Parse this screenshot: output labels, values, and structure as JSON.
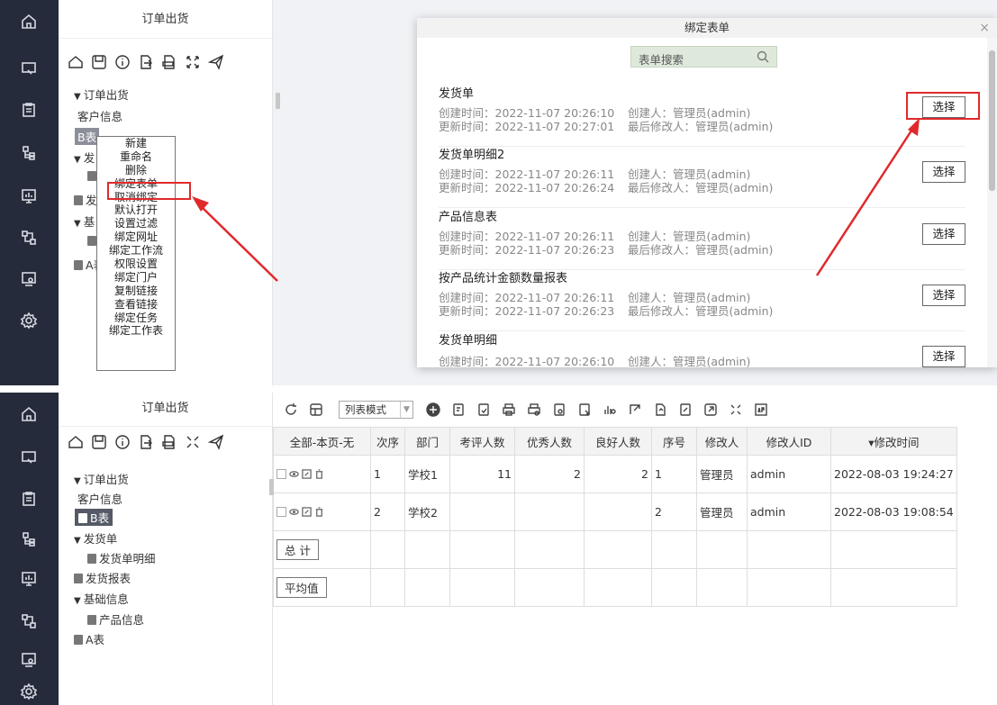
{
  "top": {
    "tree_title": "订单出货",
    "tree": [
      {
        "label": "订单出货",
        "caret": "▼"
      },
      {
        "label": "客户信息"
      },
      {
        "label": "B表"
      },
      {
        "label": "发"
      },
      {
        "label": "发"
      },
      {
        "label": "基"
      },
      {
        "label": "A表"
      }
    ],
    "context_menu": [
      "新建",
      "重命名",
      "删除",
      "绑定表单",
      "取消绑定",
      "默认打开",
      "设置过滤",
      "绑定网址",
      "绑定工作流",
      "权限设置",
      "绑定门户",
      "复制链接",
      "查看链接",
      "绑定任务",
      "绑定工作表"
    ],
    "dialog": {
      "title": "绑定表单",
      "close": "×",
      "search_placeholder": "表单搜索",
      "forms": [
        {
          "name": "发货单",
          "created": "创建时间：2022-11-07 20:26:10",
          "creator": "创建人：管理员(admin)",
          "updated": "更新时间：2022-11-07 20:27:01",
          "modifier": "最后修改人：管理员(admin)",
          "button": "选择"
        },
        {
          "name": "发货单明细2",
          "created": "创建时间：2022-11-07 20:26:11",
          "creator": "创建人：管理员(admin)",
          "updated": "更新时间：2022-11-07 20:26:24",
          "modifier": "最后修改人：管理员(admin)",
          "button": "选择"
        },
        {
          "name": "产品信息表",
          "created": "创建时间：2022-11-07 20:26:11",
          "creator": "创建人：管理员(admin)",
          "updated": "更新时间：2022-11-07 20:26:23",
          "modifier": "最后修改人：管理员(admin)",
          "button": "选择"
        },
        {
          "name": "按产品统计金额数量报表",
          "created": "创建时间：2022-11-07 20:26:11",
          "creator": "创建人：管理员(admin)",
          "updated": "更新时间：2022-11-07 20:26:23",
          "modifier": "最后修改人：管理员(admin)",
          "button": "选择"
        },
        {
          "name": "发货单明细",
          "created": "创建时间：2022-11-07 20:26:10",
          "creator": "创建人：管理员(admin)",
          "updated": "",
          "modifier": "",
          "button": "选择"
        }
      ]
    }
  },
  "bottom": {
    "tree_title": "订单出货",
    "tree": [
      {
        "label": "订单出货",
        "caret": "▼"
      },
      {
        "label": "客户信息"
      },
      {
        "label": "B表"
      },
      {
        "label": "发货单",
        "caret": "▼"
      },
      {
        "label": "发货单明细"
      },
      {
        "label": "发货报表"
      },
      {
        "label": "基础信息",
        "caret": "▼"
      },
      {
        "label": "产品信息"
      },
      {
        "label": "A表"
      }
    ],
    "view_mode": "列表模式",
    "columns": [
      "全部-本页-无",
      "次序",
      "部门",
      "考评人数",
      "优秀人数",
      "良好人数",
      "序号",
      "修改人",
      "修改人ID",
      "▾修改时间"
    ],
    "rows": [
      {
        "order": "1",
        "dept": "学校1",
        "eval": "11",
        "excellent": "2",
        "good": "2",
        "seq": "1",
        "modifier": "管理员",
        "modifier_id": "admin",
        "time": "2022-08-03 19:24:27"
      },
      {
        "order": "2",
        "dept": "学校2",
        "eval": "",
        "excellent": "",
        "good": "",
        "seq": "2",
        "modifier": "管理员",
        "modifier_id": "admin",
        "time": "2022-08-03 19:08:54"
      }
    ],
    "total_label": "总 计",
    "avg_label": "平均值"
  },
  "colors": {
    "rail": "#252b3a",
    "annotation": "#e0292b",
    "search_bg": "#dfe9db"
  }
}
